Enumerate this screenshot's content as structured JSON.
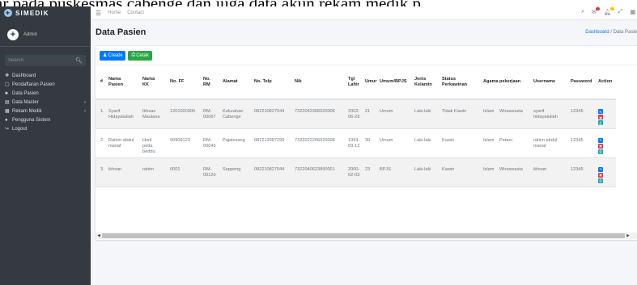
{
  "caption": "ar pada puskesmas cabenge dan juga data akun rekam medik p",
  "brand": {
    "name": "SIMEDIK"
  },
  "user": {
    "name": "Admin"
  },
  "sidebar": {
    "search_placeholder": "Search",
    "items": [
      {
        "icon": "dashboard-icon",
        "glyph": "❖",
        "label": "Dashboard",
        "has_chevron": false
      },
      {
        "icon": "register-icon",
        "glyph": "▢",
        "label": "Pendaftaran Pasien",
        "has_chevron": false
      },
      {
        "icon": "users-icon",
        "glyph": "♣",
        "label": "Data Pasien",
        "has_chevron": false
      },
      {
        "icon": "master-icon",
        "glyph": "▤",
        "label": "Data Master",
        "has_chevron": true
      },
      {
        "icon": "medical-record-icon",
        "glyph": "▦",
        "label": "Rekam Medik",
        "has_chevron": true
      },
      {
        "icon": "user-circle-icon",
        "glyph": "●",
        "label": "Pengguna Sistem",
        "has_chevron": false
      },
      {
        "icon": "logout-icon",
        "glyph": "↪",
        "label": "Logout",
        "has_chevron": false
      }
    ]
  },
  "topbar": {
    "links": [
      "Home",
      "Contact"
    ],
    "badge_colors": {
      "messages": "#dc3545",
      "notifications": "#ffc107"
    }
  },
  "page": {
    "title": "Data Pasien",
    "breadcrumb": {
      "home": "Dashboard",
      "separator": "/",
      "current": "Data Pasie"
    }
  },
  "toolbar": {
    "create_label": "Create",
    "print_label": "Cetak"
  },
  "table": {
    "headers": [
      "#",
      "Nama\nPasien",
      "Nama\nKK",
      "No. FF",
      "No.\nRM",
      "Alamat",
      "No. Telp",
      "Nik",
      "Tgl\nLahir",
      "Umur",
      "Umum/BPJS",
      "Jenis\nKelamin",
      "Status\nPerkawinan",
      "Agama",
      "pekerjaan",
      "Username",
      "Password",
      "Action"
    ],
    "rows": [
      [
        "1.",
        "Syarif\nHidayatullah",
        "Ikhsan\nMaulana",
        "1201020305",
        "RM-\n00067",
        "Kelurahan\nCabenge",
        "082210827044",
        "7322042306020006",
        "2002-\n06-23",
        "21",
        "Umum",
        "Laki-laki",
        "Tidak Kawin",
        "Islam",
        "Wiraswasta",
        "syarif\nhidayatullah",
        "12345"
      ],
      [
        "2.",
        "Rahim abdul\nmanaf",
        "Heril\npetta\nbeddu",
        "90909123",
        "RM-\n00045",
        "Pajalesang",
        "082213987299",
        "7322022206020008",
        "1993-\n03-12",
        "30",
        "Umum",
        "Laki-laki",
        "Kawin",
        "Islam",
        "Petani",
        "rahim abdul\nmanaf",
        "12345"
      ],
      [
        "3.",
        "ikhsan",
        "rahim",
        "0001",
        "RM-\n00120",
        "Soppeng",
        "082210827044",
        "7322040623890001",
        "2000-\n02-03",
        "23",
        "BPJS",
        "Laki-laki",
        "Kawin",
        "Islam",
        "Wiraswasta",
        "ikhsan",
        "12345"
      ]
    ]
  }
}
